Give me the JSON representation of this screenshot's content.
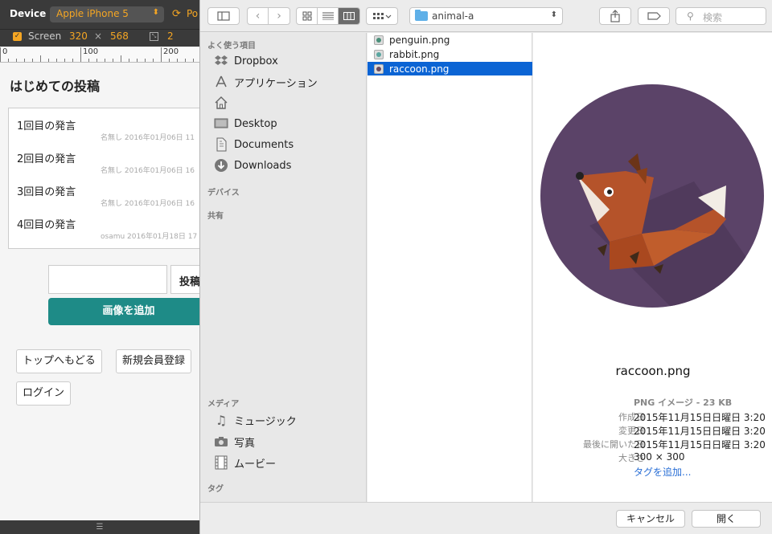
{
  "device_bar": {
    "label": "Device",
    "device_name": "Apple iPhone 5",
    "rotate_label": "Po",
    "screen_label": "Screen",
    "width": "320",
    "times": "×",
    "height": "568",
    "scale": "2",
    "ruler_ticks": [
      "0",
      "100",
      "200"
    ]
  },
  "page": {
    "title": "はじめての投稿",
    "posts": [
      {
        "message": "1回目の発言",
        "meta": "名無し 2016年01月06日 11"
      },
      {
        "message": "2回目の発言",
        "meta": "名無し 2016年01月06日 16"
      },
      {
        "message": "3回目の発言",
        "meta": "名無し 2016年01月06日 16"
      },
      {
        "message": "4回目の発言",
        "meta": "osamu 2016年01月18日 17"
      }
    ],
    "post_button": "投稿",
    "add_image_button": "画像を追加",
    "top_link": "トップへもどる",
    "register_link": "新規会員登録",
    "login_link": "ログイン"
  },
  "dialog": {
    "location": "animal-a",
    "search_placeholder": "検索",
    "sidebar": {
      "favorites_heading": "よく使う項目",
      "favorites": [
        {
          "label": "Dropbox",
          "icon": "dropbox-icon"
        },
        {
          "label": "アプリケーション",
          "icon": "applications-icon"
        },
        {
          "label": "",
          "icon": "home-icon"
        },
        {
          "label": "Desktop",
          "icon": "desktop-icon"
        },
        {
          "label": "Documents",
          "icon": "documents-icon"
        },
        {
          "label": "Downloads",
          "icon": "downloads-icon"
        }
      ],
      "devices_heading": "デバイス",
      "shared_heading": "共有",
      "media_heading": "メディア",
      "media": [
        {
          "label": "ミュージック",
          "icon": "music-icon"
        },
        {
          "label": "写真",
          "icon": "camera-icon"
        },
        {
          "label": "ムービー",
          "icon": "movie-icon"
        }
      ],
      "tags_heading": "タグ"
    },
    "files": [
      {
        "name": "penguin.png",
        "selected": false,
        "color": "#4a8f7a"
      },
      {
        "name": "rabbit.png",
        "selected": false,
        "color": "#5aa6a0"
      },
      {
        "name": "raccoon.png",
        "selected": true,
        "color": "#6b4a5e"
      }
    ],
    "preview": {
      "file_name": "raccoon.png",
      "kind": "PNG イメージ - 23 KB",
      "created_label": "作成日",
      "created": "2015年11月15日日曜日 3:20",
      "modified_label": "変更日",
      "modified": "2015年11月15日日曜日 3:20",
      "opened_label": "最後に開いた日",
      "opened": "2015年11月15日日曜日 3:20",
      "size_label": "大きさ",
      "size": "300 × 300",
      "add_tag": "タグを追加..."
    },
    "cancel_button": "キャンセル",
    "open_button": "開く"
  },
  "colors": {
    "accent_orange": "#f5a623",
    "selection_blue": "#0b64d4",
    "teal_button": "#1e8b87",
    "preview_circle": "#5b4368"
  }
}
